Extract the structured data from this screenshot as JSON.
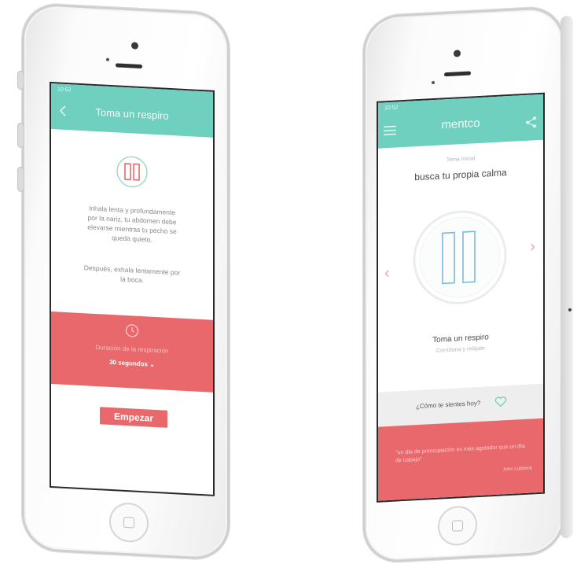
{
  "left_screen": {
    "status": {
      "time": "10:52",
      "battery": ""
    },
    "nav_title": "Toma un respiro",
    "back_icon": "chevron-left-icon",
    "instructions": [
      "Inhala lenta y profundamente",
      "por la nariz, tu abdomen debe",
      "elevarse mientras tu pecho se",
      "queda quieto."
    ],
    "exhale": [
      "Después, exhala lentamente por",
      "la boca."
    ],
    "duration": {
      "label": "Duración de la respiración",
      "value": "30 segundos",
      "icon": "clock-icon"
    },
    "start_button": "Empezar",
    "colors": {
      "teal": "#6fd0bf",
      "coral": "#e8686c"
    }
  },
  "right_screen": {
    "status": {
      "time": "10:52"
    },
    "app_title": "mentco",
    "menu_icon": "hamburger-menu-icon",
    "share_icon": "share-icon",
    "kicker": "Tema inicial",
    "headline": "busca tu propia calma",
    "activity_title": "Toma un respiro",
    "activity_subtitle": "Corrobora y relájate",
    "mood_prompt": "¿Cómo te sientes hoy?",
    "quote": "\"un día de preocupación es más agotador que un día de trabajo\"",
    "quote_author": "John Lubbock",
    "colors": {
      "teal": "#6fd0bf",
      "coral": "#e8686c",
      "ring": "#e9eeee"
    }
  }
}
